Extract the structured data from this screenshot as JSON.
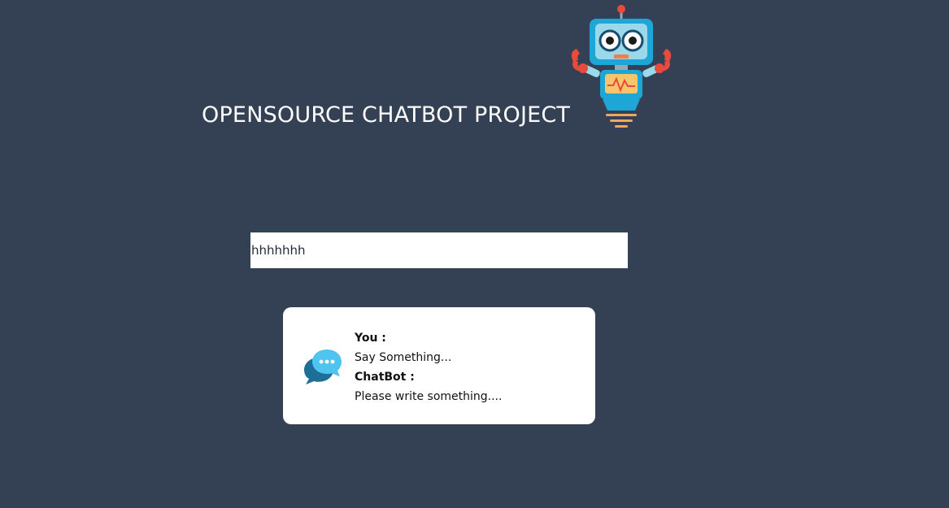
{
  "header": {
    "title": "OPENSOURCE CHATBOT PROJECT",
    "logo_icon": "robot-icon"
  },
  "chat": {
    "input_value": "hhhhhhh",
    "you_label": "You :",
    "you_message": "Say Something...",
    "bot_label": "ChatBot :",
    "bot_message": "Please write something....",
    "icon": "chat-bubbles-icon"
  },
  "colors": {
    "background": "#344054",
    "card": "#ffffff",
    "robot_accent": "#1ea7d6",
    "robot_arms": "#e84a3b"
  }
}
